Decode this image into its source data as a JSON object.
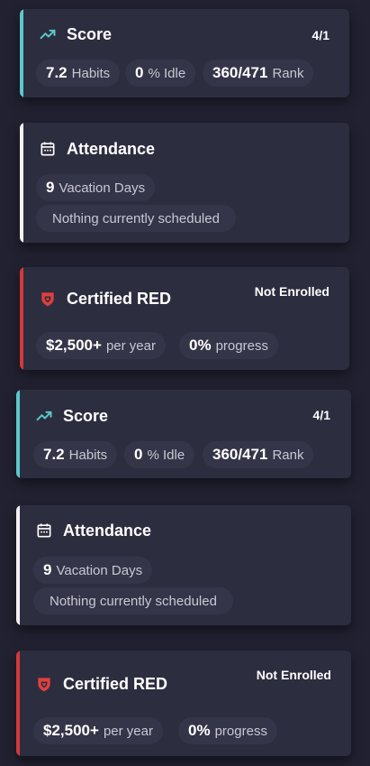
{
  "colors": {
    "background": "#212131",
    "card": "#2d2d40",
    "pill": "#353549",
    "accent_score": "#5cc7c9",
    "accent_attendance": "#f2f2f2",
    "accent_certified": "#d23a3a",
    "icon_score": "#5cc7c9",
    "icon_certified": "#e0403c"
  },
  "cards": [
    {
      "type": "score",
      "title": "Score",
      "icon": "trending-up-icon",
      "corner": "4/1",
      "stats": [
        {
          "value": "7.2",
          "label": "Habits"
        },
        {
          "value": "0",
          "label": "% Idle"
        },
        {
          "value": "360/471",
          "label": "Rank"
        }
      ]
    },
    {
      "type": "attendance",
      "title": "Attendance",
      "icon": "calendar-icon",
      "stats": [
        {
          "value": "9",
          "label": "Vacation Days"
        }
      ],
      "note": "Nothing currently scheduled"
    },
    {
      "type": "certified",
      "title": "Certified RED",
      "icon": "red-shield-logo-icon",
      "corner": "Not Enrolled",
      "stats": [
        {
          "value": "$2,500+",
          "label": "per year"
        },
        {
          "value": "0%",
          "label": "progress"
        }
      ]
    },
    {
      "type": "score",
      "title": "Score",
      "icon": "trending-up-icon",
      "corner": "4/1",
      "stats": [
        {
          "value": "7.2",
          "label": "Habits"
        },
        {
          "value": "0",
          "label": "% Idle"
        },
        {
          "value": "360/471",
          "label": "Rank"
        }
      ]
    },
    {
      "type": "attendance",
      "title": "Attendance",
      "icon": "calendar-icon",
      "stats": [
        {
          "value": "9",
          "label": "Vacation Days"
        }
      ],
      "note": "Nothing currently scheduled"
    },
    {
      "type": "certified",
      "title": "Certified RED",
      "icon": "red-shield-logo-icon",
      "corner": "Not Enrolled",
      "stats": [
        {
          "value": "$2,500+",
          "label": "per year"
        },
        {
          "value": "0%",
          "label": "progress"
        }
      ]
    }
  ]
}
